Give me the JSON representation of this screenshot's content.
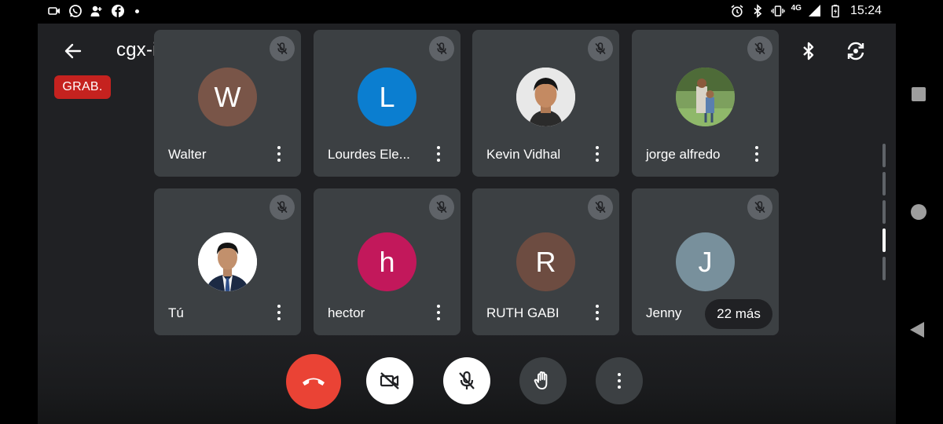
{
  "status_bar": {
    "time": "15:24",
    "network": "4G",
    "left_icons": [
      "video-notification-icon",
      "whatsapp-icon",
      "contacts-icon",
      "facebook-icon",
      "more-notifications-dot"
    ],
    "right_icons": [
      "alarm-icon",
      "bluetooth-icon",
      "vibrate-icon",
      "signal-icon",
      "battery-charging-icon"
    ]
  },
  "header": {
    "meeting_code": "cgx-iadd-uxj",
    "recording_badge": "GRAB."
  },
  "participants": [
    {
      "name": "Walter",
      "initial": "W",
      "avatar_color": "#795548",
      "avatar_type": "initial",
      "muted": true
    },
    {
      "name": "Lourdes Ele...",
      "initial": "L",
      "avatar_color": "#0b7ed0",
      "avatar_type": "initial",
      "muted": true
    },
    {
      "name": "Kevin Vidhal",
      "initial": "",
      "avatar_color": "#e8e8e8",
      "avatar_type": "photo",
      "muted": true
    },
    {
      "name": "jorge alfredo",
      "initial": "",
      "avatar_color": "#6c8f4e",
      "avatar_type": "photo",
      "muted": true
    },
    {
      "name": "Tú",
      "initial": "",
      "avatar_color": "#ffffff",
      "avatar_type": "photo",
      "muted": true
    },
    {
      "name": "hector",
      "initial": "h",
      "avatar_color": "#c2185b",
      "avatar_type": "initial",
      "muted": true
    },
    {
      "name": "RUTH GABI",
      "initial": "R",
      "avatar_color": "#6d4c41",
      "avatar_type": "initial",
      "muted": true
    },
    {
      "name": "Jenny",
      "initial": "J",
      "avatar_color": "#78909c",
      "avatar_type": "initial",
      "muted": true
    }
  ],
  "more_participants": "22 más",
  "controls": {
    "end_call_color": "#ea4335",
    "buttons": [
      "end-call-icon",
      "camera-off-icon",
      "mic-off-icon",
      "raise-hand-icon",
      "more-options-icon"
    ]
  },
  "colors": {
    "background": "#202124",
    "tile": "#3c4043",
    "recording": "#c5221f"
  }
}
